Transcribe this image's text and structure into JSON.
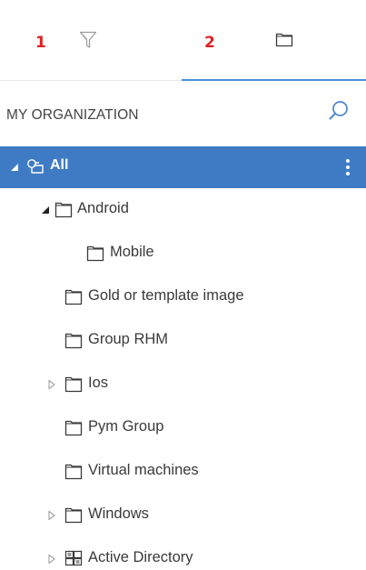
{
  "tabs": [
    {
      "number": "1",
      "icon": "filter-icon",
      "active": false
    },
    {
      "number": "2",
      "icon": "folder-icon",
      "active": true
    }
  ],
  "header": {
    "title": "MY ORGANIZATION",
    "search_icon": "search-icon"
  },
  "tree": {
    "root": {
      "label": "All",
      "icon": "multi-folder-icon",
      "expanded": true
    },
    "items": [
      {
        "label": "Android",
        "level": 1,
        "expander": "expanded",
        "icon": "folder-icon"
      },
      {
        "label": "Mobile",
        "level": 2,
        "expander": "none",
        "icon": "folder-icon"
      },
      {
        "label": "Gold or template image",
        "level": 1,
        "expander": "none",
        "icon": "folder-icon"
      },
      {
        "label": "Group RHM",
        "level": 1,
        "expander": "none",
        "icon": "folder-icon"
      },
      {
        "label": "Ios",
        "level": 1,
        "expander": "collapsed",
        "icon": "folder-icon"
      },
      {
        "label": "Pym Group",
        "level": 1,
        "expander": "none",
        "icon": "folder-icon"
      },
      {
        "label": "Virtual machines",
        "level": 1,
        "expander": "none",
        "icon": "folder-icon"
      },
      {
        "label": "Windows",
        "level": 1,
        "expander": "collapsed",
        "icon": "folder-icon"
      },
      {
        "label": "Active Directory",
        "level": 1,
        "expander": "collapsed",
        "icon": "active-directory-icon"
      }
    ]
  },
  "colors": {
    "accent": "#3e7bc4",
    "tab_number": "#e02020",
    "tab_underline": "#4a8fd4",
    "text": "#3a3a3a"
  }
}
